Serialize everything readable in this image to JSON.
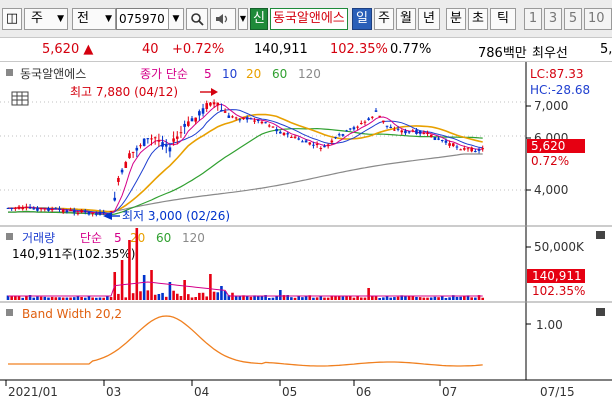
{
  "toolbar": {
    "type_label": "주",
    "code_prefix": "전",
    "code_value": "075970",
    "new_label": "신",
    "stock_name": "동국알앤에스",
    "periods": [
      "일",
      "주",
      "월",
      "년",
      "분",
      "초",
      "틱"
    ],
    "intervals": [
      "1",
      "3",
      "5",
      "10"
    ]
  },
  "quote": {
    "price": "5,620",
    "change": "40",
    "change_pct": "+0.72%",
    "volume": "140,911",
    "vol_ratio": "102.35%",
    "turnover_ratio": "0.77%",
    "amount": "786백만",
    "best_label": "최우선",
    "extra": "5,"
  },
  "price_panel": {
    "stock_name": "동국알앤에스",
    "ma_label": "종가 단순",
    "ma_periods": [
      "5",
      "10",
      "20",
      "60",
      "120"
    ],
    "high_label": "최고 7,880 (04/12)",
    "low_label": "최저 3,000 (02/26)",
    "lc": "LC:87.33",
    "hc": "HC:-28.68",
    "price_ticks": [
      "7,000",
      "6,000",
      "4,000"
    ],
    "current_price": "5,620",
    "current_pct": "0.72%"
  },
  "volume_panel": {
    "title": "거래량",
    "ma_label": "단순",
    "ma_periods": [
      "5",
      "20",
      "60",
      "120"
    ],
    "value_text": "140,911주(102.35%)",
    "tick": "50,000K",
    "current_value": "140,911",
    "current_pct": "102.35%"
  },
  "bw_panel": {
    "title": "Band Width 20,2",
    "tick": "1.00"
  },
  "x_axis": {
    "labels": [
      "2021/01",
      "03",
      "04",
      "05",
      "06",
      "07"
    ],
    "cursor_date": "07/15"
  },
  "colors": {
    "up": "#e60012",
    "down": "#0033cc",
    "ma5": "#d4008a",
    "ma10": "#2040d0",
    "ma20": "#e8a000",
    "ma60": "#30a030",
    "ma120": "#8a8a8a",
    "bw": "#f08020"
  }
}
